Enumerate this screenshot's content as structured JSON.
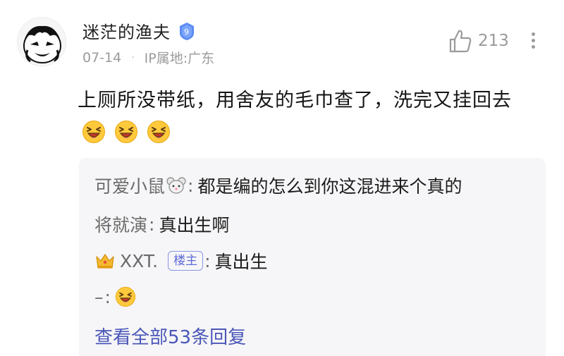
{
  "post": {
    "username": "迷茫的渔夫",
    "level": "9",
    "date": "07-14",
    "separator": "·",
    "location": "IP属地:广东",
    "like_count": "213",
    "text": "上厕所没带纸，用舍友的毛巾查了，洗完又挂回去",
    "emoji_count": 3
  },
  "replies": [
    {
      "name": "可爱小鼠",
      "colon": ":",
      "text": "都是编的怎么到你这混进来个真的"
    },
    {
      "name": "将就演",
      "colon": ":",
      "text": "真出生啊"
    },
    {
      "name": "XXT.",
      "tag": "楼主",
      "colon": ":",
      "text": "真出生"
    },
    {
      "name": "–",
      "colon": ":",
      "text": ""
    }
  ],
  "view_all": "查看全部53条回复",
  "icons": {
    "like": "thumbs-up-icon",
    "more": "more-vertical-icon",
    "crown": "crown-icon",
    "emoji": "laughing-emoji-icon",
    "rat": "rat-face-icon",
    "badge": "level-badge-icon"
  },
  "colors": {
    "link": "#4a57b8",
    "host_tag": "#5e6bd8",
    "badge": "#5b8cf5",
    "reply_bg": "#f6f6f8"
  }
}
